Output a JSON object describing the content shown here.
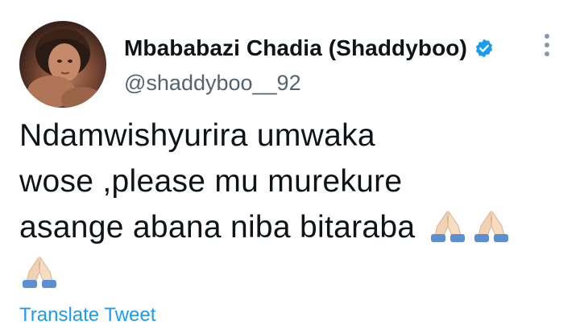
{
  "tweet": {
    "author": {
      "display_name": "Mbababazi Chadia (Shaddyboo)",
      "handle": "@shaddyboo__92",
      "verified": true
    },
    "text_lines": [
      "Ndamwishyurira umwaka",
      "wose ,please mu murekure",
      "asange abana niba bitaraba"
    ],
    "emoji": "folded-hands",
    "translate_label": "Translate Tweet"
  },
  "icons": {
    "verified": "verified-badge-icon",
    "more": "more-options-icon",
    "pray": "folded-hands-icon"
  },
  "colors": {
    "accent": "#1d9bf0",
    "text": "#0f1419",
    "secondary": "#536471"
  }
}
